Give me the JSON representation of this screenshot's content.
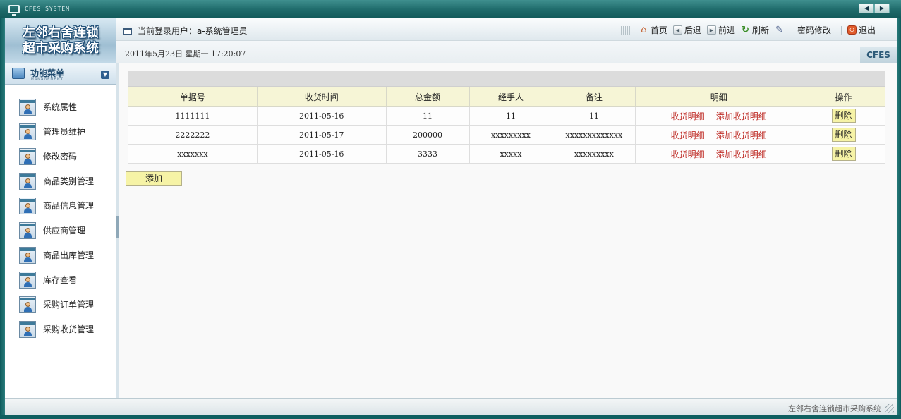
{
  "window": {
    "title": "CFES SYSTEM"
  },
  "header": {
    "logo_line1": "左邻右舍连锁",
    "logo_line2": "超市采购系统",
    "user_label": "当前登录用户：a-系统管理员",
    "date_text": "2011年5月23日  星期一  17:20:07",
    "brand_tag": "CFES",
    "nav": {
      "home": "首页",
      "back": "后退",
      "forward": "前进",
      "refresh": "刷新",
      "change_password": "密码修改",
      "logout": "退出"
    }
  },
  "sidebar": {
    "title": "功能菜单",
    "subtitle": "MANAGEMENT",
    "items": [
      {
        "label": "系统属性"
      },
      {
        "label": "管理员维护"
      },
      {
        "label": "修改密码"
      },
      {
        "label": "商品类别管理"
      },
      {
        "label": "商品信息管理"
      },
      {
        "label": "供应商管理"
      },
      {
        "label": "商品出库管理"
      },
      {
        "label": "库存查看"
      },
      {
        "label": "采购订单管理"
      },
      {
        "label": "采购收货管理"
      }
    ]
  },
  "table": {
    "columns": [
      "单据号",
      "收货时间",
      "总金额",
      "经手人",
      "备注",
      "明细",
      "操作"
    ],
    "detail_link": "收货明细",
    "add_detail_link": "添加收货明细",
    "delete_label": "删除",
    "rows": [
      {
        "id": "1111111",
        "time": "2011-05-16",
        "amount": "11",
        "handler": "11",
        "note": "11"
      },
      {
        "id": "2222222",
        "time": "2011-05-17",
        "amount": "200000",
        "handler": "xxxxxxxxx",
        "note": "xxxxxxxxxxxxx"
      },
      {
        "id": "xxxxxxx",
        "time": "2011-05-16",
        "amount": "3333",
        "handler": "xxxxx",
        "note": "xxxxxxxxx"
      }
    ]
  },
  "actions": {
    "add_label": "添加"
  },
  "statusbar": {
    "text": "左邻右舍连锁超市采购系统"
  }
}
